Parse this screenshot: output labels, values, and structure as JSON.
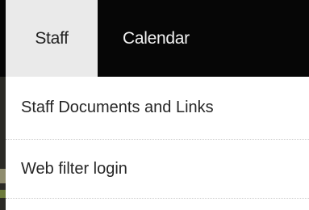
{
  "nav": {
    "tabs": [
      {
        "label": "Staff",
        "active": true
      },
      {
        "label": "Calendar",
        "active": false
      }
    ]
  },
  "dropdown": {
    "items": [
      {
        "label": "Staff Documents and Links"
      },
      {
        "label": "Web filter login"
      }
    ]
  },
  "colors": {
    "nav_background": "#060606",
    "active_tab_background": "#eaeaea",
    "menu_background": "#ffffff",
    "menu_text": "#262626",
    "divider": "#c9c9c9"
  }
}
